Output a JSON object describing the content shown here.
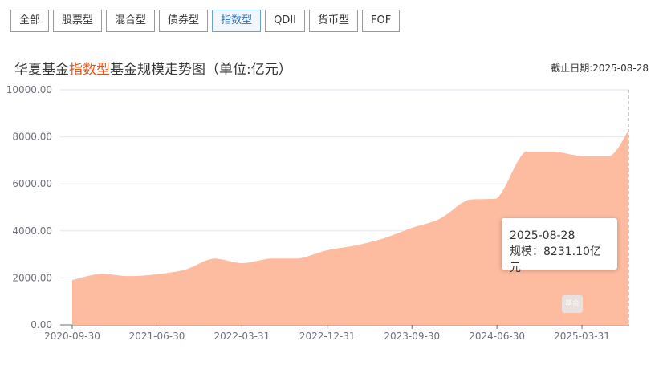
{
  "tabs": [
    {
      "label": "全部",
      "active": false
    },
    {
      "label": "股票型",
      "active": false
    },
    {
      "label": "混合型",
      "active": false
    },
    {
      "label": "债券型",
      "active": false
    },
    {
      "label": "指数型",
      "active": true
    },
    {
      "label": "QDII",
      "active": false
    },
    {
      "label": "货币型",
      "active": false
    },
    {
      "label": "FOF",
      "active": false
    }
  ],
  "title": {
    "prefix": "华夏基金",
    "highlight": "指数型",
    "suffix": "基金规模走势图（单位:亿元）"
  },
  "as_of": "截止日期:2025-08-28",
  "tooltip": {
    "date": "2025-08-28",
    "label": "规模",
    "value": "8231.10亿元"
  },
  "watermark": {
    "logo_text": "基金"
  },
  "colors": {
    "area": "#fdbb9f",
    "grid": "#e0e6f1",
    "axis": "#6e7079",
    "highlight": "#e2561f",
    "active_tab": "#2f6fb7"
  },
  "chart_data": {
    "type": "area",
    "ylim": [
      0,
      10000
    ],
    "y_ticks": [
      "0.00",
      "2000.00",
      "4000.00",
      "6000.00",
      "8000.00",
      "10000.00"
    ],
    "x_tick_labels": [
      "2020-09-30",
      "2021-06-30",
      "2022-03-31",
      "2022-12-31",
      "2023-09-30",
      "2024-06-30",
      "2025-03-31"
    ],
    "categories": [
      "2020-09-30",
      "2020-12-31",
      "2021-03-31",
      "2021-06-30",
      "2021-09-30",
      "2021-12-31",
      "2022-03-31",
      "2022-06-30",
      "2022-09-30",
      "2022-12-31",
      "2023-03-31",
      "2023-06-30",
      "2023-09-30",
      "2023-12-31",
      "2024-03-31",
      "2024-06-30",
      "2024-09-30",
      "2024-12-31",
      "2025-03-31",
      "2025-06-30",
      "2025-08-28"
    ],
    "series": [
      {
        "values": [
          1880,
          2150,
          2050,
          2130,
          2330,
          2800,
          2600,
          2800,
          2800,
          3150,
          3350,
          3650,
          4100,
          4500,
          5300,
          5350,
          7350,
          7350,
          7150,
          7150,
          8231.1
        ]
      }
    ]
  }
}
